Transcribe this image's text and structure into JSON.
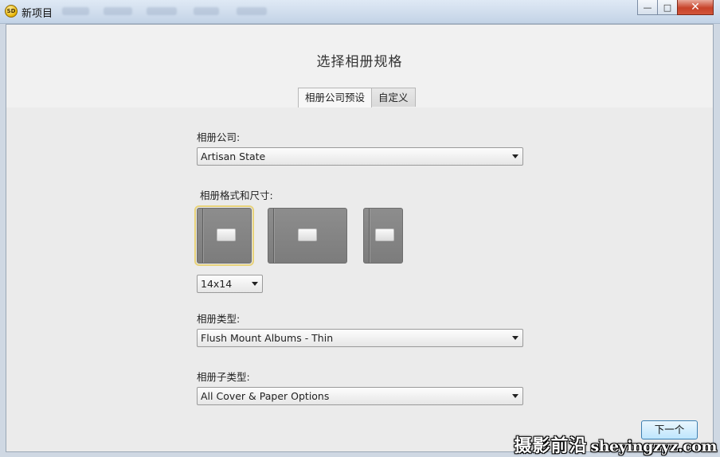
{
  "window": {
    "title": "新项目",
    "app_icon_text": "SD",
    "controls": {
      "minimize": "—",
      "maximize": "□",
      "close": "✕"
    }
  },
  "page": {
    "title": "选择相册规格",
    "tabs": [
      {
        "label": "相册公司预设",
        "active": true
      },
      {
        "label": "自定义",
        "active": false
      }
    ]
  },
  "form": {
    "company": {
      "label": "相册公司:",
      "value": "Artisan State"
    },
    "format": {
      "label": "相册格式和尺寸:",
      "options": [
        {
          "name": "square",
          "selected": true
        },
        {
          "name": "landscape",
          "selected": false
        },
        {
          "name": "portrait",
          "selected": false
        }
      ],
      "size_value": "14x14"
    },
    "album_type": {
      "label": "相册类型:",
      "value": "Flush Mount Albums - Thin"
    },
    "album_subtype": {
      "label": "相册子类型:",
      "value": "All Cover & Paper Options"
    }
  },
  "footer": {
    "next_label": "下一个"
  },
  "watermark": {
    "chinese": "摄影前沿",
    "english": "sheyingzyz.com"
  },
  "colors": {
    "selected_outline": "#e7d27a",
    "next_button_border": "#3c7fb1"
  }
}
